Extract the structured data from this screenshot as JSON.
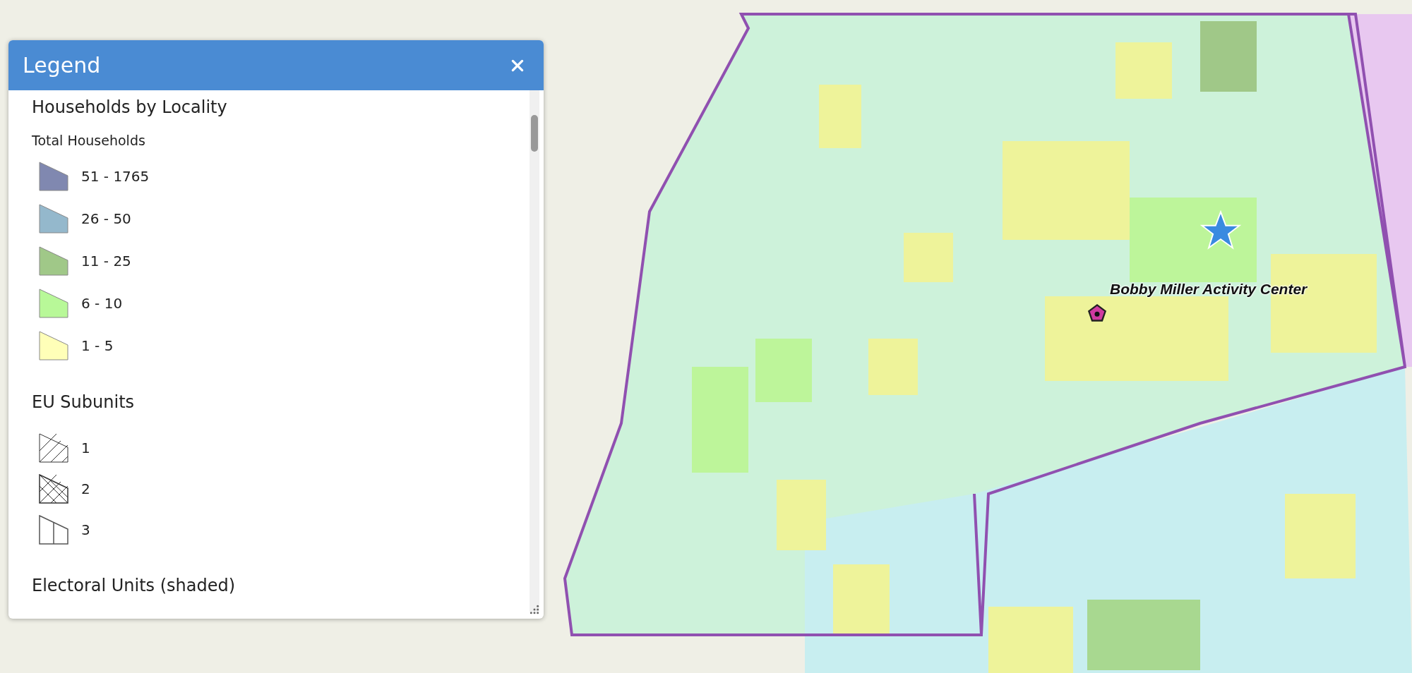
{
  "legend": {
    "title": "Legend",
    "sections": [
      {
        "title": "Households by Locality",
        "subtitle": "Total Households",
        "items": [
          {
            "label": "51 - 1765",
            "kind": "fill",
            "color": "#8088b0"
          },
          {
            "label": "26 - 50",
            "kind": "fill",
            "color": "#94b8cc"
          },
          {
            "label": "11 - 25",
            "kind": "fill",
            "color": "#a0c888"
          },
          {
            "label": "6 - 10",
            "kind": "fill",
            "color": "#b8f898"
          },
          {
            "label": "1 - 5",
            "kind": "fill",
            "color": "#ffffb8"
          }
        ]
      },
      {
        "title": "EU Subunits",
        "items": [
          {
            "label": "1",
            "kind": "hatch"
          },
          {
            "label": "2",
            "kind": "crosshatch"
          },
          {
            "label": "3",
            "kind": "split"
          }
        ]
      },
      {
        "title": "Electoral Units (shaded)"
      }
    ]
  },
  "map": {
    "place_label": "Bobby Miller Activity Center"
  }
}
